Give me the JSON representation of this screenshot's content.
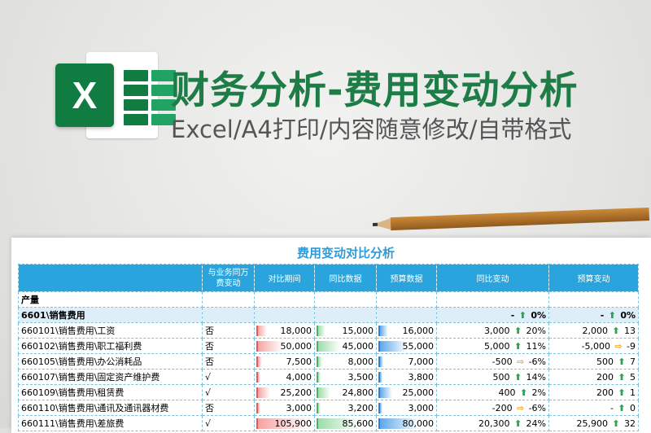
{
  "banner": {
    "logo_letter": "X",
    "title": "财务分析-费用变动分析",
    "subtitle": "Excel/A4打印/内容随意修改/自带格式"
  },
  "sheet": {
    "title": "费用变动对比分析",
    "headers": {
      "name": "",
      "flag": "与业务同万费变动",
      "period": "对比期间",
      "yoy_data": "同比数据",
      "budget_data": "预算数据",
      "yoy_change": "同比变动",
      "budget_change": "预算变动"
    },
    "category_label": "产量",
    "subtotal": {
      "name": "6601\\销售费用",
      "yoy_amount": "-",
      "yoy_pct": "0%",
      "budget_amount": "-",
      "budget_pct": "0%"
    },
    "rows": [
      {
        "name": "660101\\销售费用\\工资",
        "flag": "否",
        "period": "18,000",
        "yoy": "15,000",
        "budget": "16,000",
        "yoy_amount": "3,000",
        "yoy_dir": "up",
        "yoy_pct": "20%",
        "budget_amount": "2,000",
        "budget_dir": "up",
        "budget_pct": "13"
      },
      {
        "name": "660102\\销售费用\\职工福利费",
        "flag": "否",
        "period": "50,000",
        "yoy": "45,000",
        "budget": "55,000",
        "yoy_amount": "5,000",
        "yoy_dir": "up",
        "yoy_pct": "11%",
        "budget_amount": "-5,000",
        "budget_dir": "right",
        "budget_pct": "-9"
      },
      {
        "name": "660105\\销售费用\\办公消耗品",
        "flag": "否",
        "period": "7,500",
        "yoy": "8,000",
        "budget": "7,000",
        "yoy_amount": "-500",
        "yoy_dir": "right",
        "yoy_pct": "-6%",
        "budget_amount": "500",
        "budget_dir": "up",
        "budget_pct": "7"
      },
      {
        "name": "660107\\销售费用\\固定资产维护费",
        "flag": "√",
        "period": "4,000",
        "yoy": "3,500",
        "budget": "3,800",
        "yoy_amount": "500",
        "yoy_dir": "up",
        "yoy_pct": "14%",
        "budget_amount": "200",
        "budget_dir": "up",
        "budget_pct": "5"
      },
      {
        "name": "660109\\销售费用\\租赁费",
        "flag": "√",
        "period": "25,200",
        "yoy": "24,800",
        "budget": "25,000",
        "yoy_amount": "400",
        "yoy_dir": "up",
        "yoy_pct": "2%",
        "budget_amount": "200",
        "budget_dir": "up",
        "budget_pct": "1"
      },
      {
        "name": "660110\\销售费用\\通讯及通讯器材费",
        "flag": "否",
        "period": "3,000",
        "yoy": "3,200",
        "budget": "3,000",
        "yoy_amount": "-200",
        "yoy_dir": "right",
        "yoy_pct": "-6%",
        "budget_amount": "-",
        "budget_dir": "up",
        "budget_pct": "0"
      },
      {
        "name": "660111\\销售费用\\差旅费",
        "flag": "√",
        "period": "105,900",
        "yoy": "85,600",
        "budget": "80,000",
        "yoy_amount": "20,300",
        "yoy_dir": "up",
        "yoy_pct": "24%",
        "budget_amount": "25,900",
        "budget_dir": "up",
        "budget_pct": "32"
      }
    ],
    "bar_scale_max": 105900
  },
  "colors": {
    "title_green": "#1e7c47",
    "header_blue": "#29a4dc",
    "up_arrow": "#2aa44f",
    "flat_arrow": "#e8a422"
  }
}
